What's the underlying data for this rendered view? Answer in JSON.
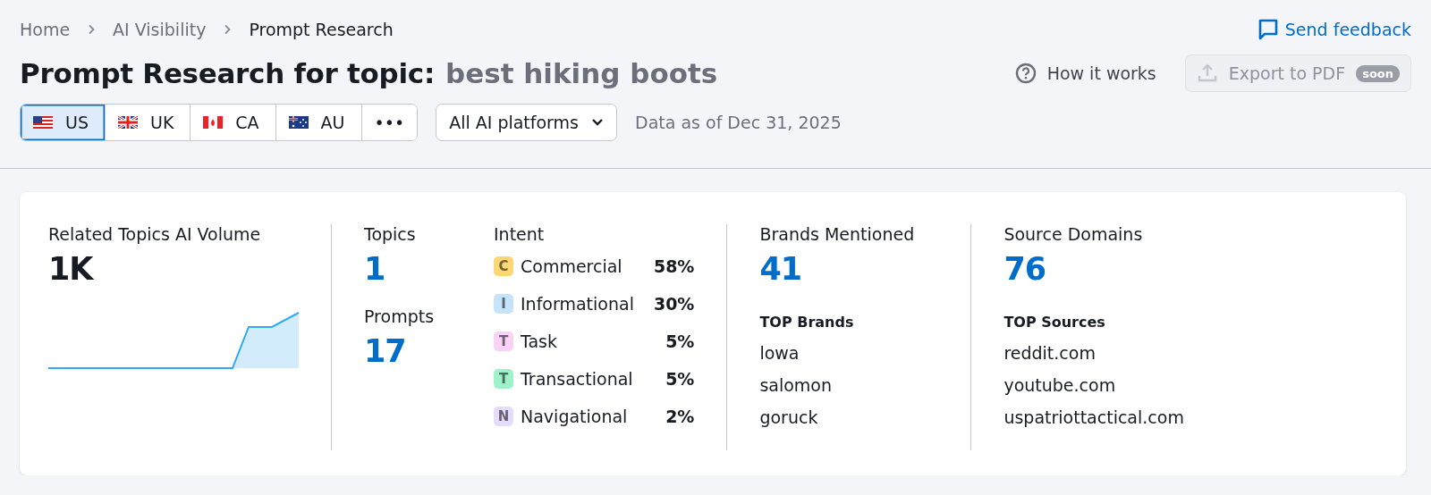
{
  "breadcrumbs": [
    {
      "label": "Home",
      "selected": false
    },
    {
      "label": "AI Visibility",
      "selected": false
    },
    {
      "label": "Prompt Research",
      "selected": true
    }
  ],
  "feedback": {
    "label": "Send feedback"
  },
  "title": {
    "prefix": "Prompt Research for topic:",
    "topic": "best hiking boots"
  },
  "how_it_works": {
    "label": "How it works"
  },
  "export": {
    "label": "Export to PDF",
    "badge": "soon",
    "disabled": true
  },
  "countries": [
    {
      "kind": "us",
      "label": "US",
      "selected": true
    },
    {
      "kind": "uk",
      "label": "UK",
      "selected": false
    },
    {
      "kind": "ca",
      "label": "CA",
      "selected": false
    },
    {
      "kind": "au",
      "label": "AU",
      "selected": false
    },
    {
      "kind": "more",
      "label": "•••",
      "selected": false
    }
  ],
  "platform_select": {
    "value": "All AI platforms"
  },
  "data_date": "Data as of Dec 31, 2025",
  "volume": {
    "label": "Related Topics AI Volume",
    "value": "1K"
  },
  "topics": {
    "label": "Topics",
    "value": "1"
  },
  "prompts": {
    "label": "Prompts",
    "value": "17"
  },
  "intent": {
    "label": "Intent",
    "items": [
      {
        "letter": "C",
        "name": "Commercial",
        "share": "58%",
        "color": "#fbd874"
      },
      {
        "letter": "I",
        "name": "Informational",
        "share": "30%",
        "color": "#c5e3fa"
      },
      {
        "letter": "T",
        "name": "Task",
        "share": "5%",
        "color": "#fad2f8"
      },
      {
        "letter": "T",
        "name": "Transactional",
        "share": "5%",
        "color": "#9ef2c9"
      },
      {
        "letter": "N",
        "name": "Navigational",
        "share": "2%",
        "color": "#e6dbfb"
      }
    ]
  },
  "brands": {
    "label": "Brands Mentioned",
    "value": "41",
    "top_label": "TOP Brands",
    "top": [
      "lowa",
      "salomon",
      "goruck"
    ]
  },
  "sources": {
    "label": "Source Domains",
    "value": "76",
    "top_label": "TOP Sources",
    "top": [
      "reddit.com",
      "youtube.com",
      "uspatriottactical.com"
    ]
  }
}
